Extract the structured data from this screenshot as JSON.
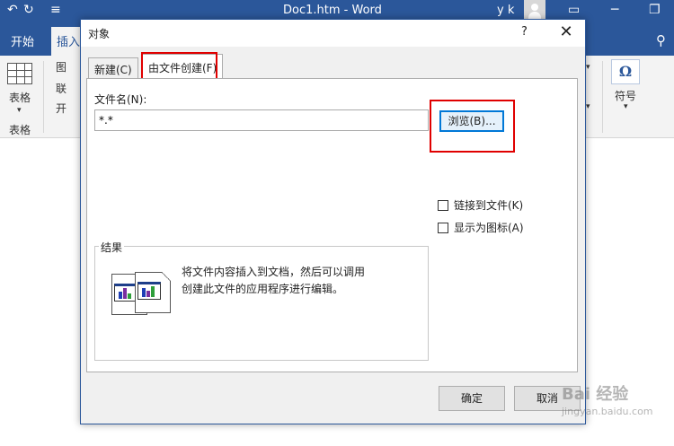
{
  "titlebar": {
    "title": "Doc1.htm  -  Word",
    "user": "y k",
    "undo_glyph": "↶",
    "redo_glyph": "↻",
    "qat_glyph": "≡"
  },
  "ribbon": {
    "tabs": [
      "开始",
      "插入"
    ],
    "table_label": "表格",
    "table_group_label": "表格",
    "symbol_label": "符号",
    "omega_glyph": "Ω",
    "partial_items": [
      "图",
      "联",
      "开"
    ]
  },
  "dialog": {
    "title": "对象",
    "help_glyph": "?",
    "close_glyph": "✕",
    "tabs": {
      "new": "新建(C)",
      "from_file": "由文件创建(F)"
    },
    "filename_label": "文件名(N):",
    "filename_value": "*.*",
    "browse_label": "浏览(B)...",
    "link_to_file_label": "链接到文件(K)",
    "show_as_icon_label": "显示为图标(A)",
    "result_label": "结果",
    "result_text": "将文件内容插入到文档，然后可以调用创建此文件的应用程序进行编辑。",
    "ok_label": "确定",
    "cancel_label": "取消"
  },
  "watermark": {
    "brand": "Bai 经验",
    "url": "jingyan.baidu.com"
  },
  "colors": {
    "word_blue": "#2b579a",
    "highlight_red": "#e00000",
    "focus_blue": "#0078d7"
  }
}
